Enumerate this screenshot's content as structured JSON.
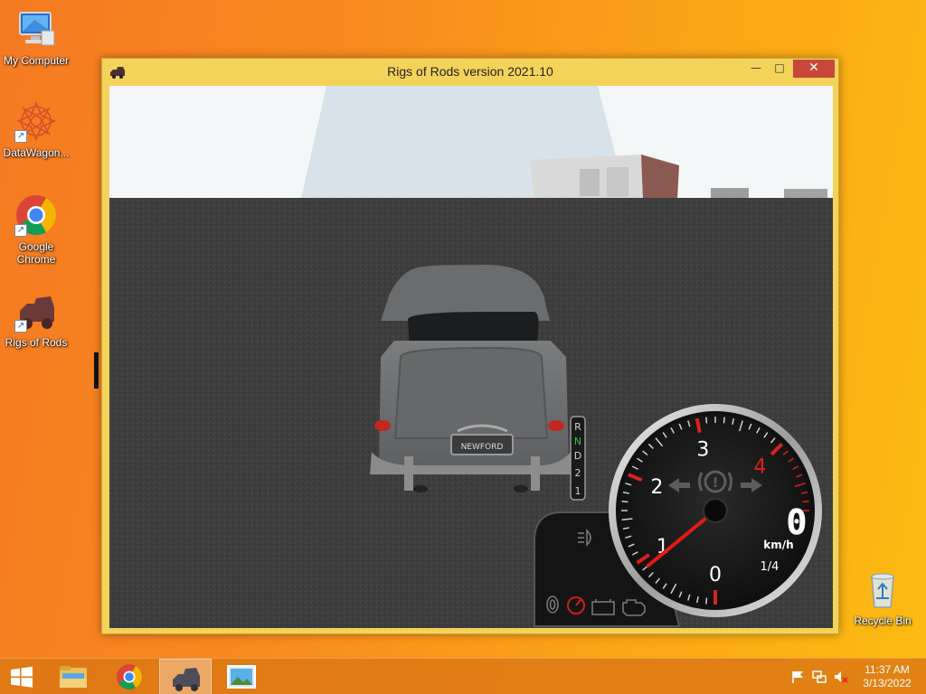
{
  "desktop": {
    "icons": [
      {
        "label": "My Computer",
        "icon": "computer-icon"
      },
      {
        "label": "DataWagon...",
        "icon": "datawagon-icon"
      },
      {
        "label": "Google Chrome",
        "icon": "chrome-icon"
      },
      {
        "label": "Rigs of Rods",
        "icon": "rigs-of-rods-icon"
      },
      {
        "label": "Recycle Bin",
        "icon": "recycle-bin-icon"
      }
    ]
  },
  "window": {
    "title": "Rigs of Rods version 2021.10",
    "buttons": {
      "minimize": "—",
      "maximize": "□",
      "close": "✕"
    }
  },
  "game": {
    "license_plate": "NEWFORD",
    "gear_indicator": [
      "R",
      "N",
      "D",
      "2",
      "1"
    ],
    "active_gear": "N",
    "speed": "0",
    "speed_unit": "km/h",
    "gear_ratio": "1/4",
    "tachometer": {
      "ticks": [
        "0",
        "1",
        "2",
        "3",
        "4"
      ],
      "needle_value": 0.9,
      "max": 4.8
    },
    "colors": {
      "sky": "#f4f7f8",
      "ground": "#3e3e3e",
      "car": "#6d6f70",
      "redline": "#d8221c",
      "neutral": "#36c43a"
    }
  },
  "taskbar": {
    "time": "11:37 AM",
    "date": "3/13/2022"
  }
}
